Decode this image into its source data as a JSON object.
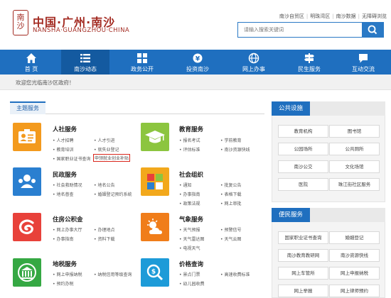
{
  "header": {
    "logo_mark": "南沙",
    "logo_cn": "中国·广州·南沙",
    "logo_en": "NANSHA·GUANGZHOU·CHINA",
    "top_links": [
      "南沙自贸区",
      "明珠湾区",
      "南沙数据",
      "无障碍浏览"
    ],
    "search_placeholder": "请输入搜索关键词",
    "search_icon": "search-icon"
  },
  "nav": {
    "items": [
      {
        "label": "首 页",
        "icon": "home-icon"
      },
      {
        "label": "南沙动态",
        "icon": "list-icon",
        "active": true
      },
      {
        "label": "政务公开",
        "icon": "grid-icon"
      },
      {
        "label": "投资南沙",
        "icon": "coin-icon"
      },
      {
        "label": "网上办事",
        "icon": "globe-icon"
      },
      {
        "label": "民生服务",
        "icon": "signpost-icon"
      },
      {
        "label": "互动交流",
        "icon": "chat-icon"
      }
    ]
  },
  "welcome": "欢迎您光临南沙区政府！",
  "main": {
    "section_title": "主题服务",
    "services": [
      {
        "title": "人社服务",
        "color": "#f39a1d",
        "icon": "id-card-icon",
        "links": [
          "人才招聘",
          "人才引进",
          "教育培训",
          "就失业登记",
          "国家职业证书查询",
          "申领就业创业补贴"
        ],
        "highlight": 5
      },
      {
        "title": "教育服务",
        "color": "#8cc53f",
        "icon": "graduation-cap-icon",
        "links": [
          "报名考试",
          "学前教育",
          "评估标准",
          "南沙资源快线"
        ]
      },
      {
        "title": "民政服务",
        "color": "#2a7fd0",
        "icon": "people-icon",
        "links": [
          "社会救助情况",
          "地名公告",
          "地名普查",
          "婚姻登记预约系统"
        ]
      },
      {
        "title": "社会组织",
        "color": "#f2a81c",
        "icon": "org-grid-icon",
        "links": [
          "通知",
          "批复公告",
          "办事指南",
          "表格下载",
          "政策法规",
          "网上审批"
        ]
      },
      {
        "title": "住房公积金",
        "color": "#e8413a",
        "icon": "swirl-icon",
        "links": [
          "网上办事大厅",
          "办理地点",
          "办事指南",
          "资料下载"
        ]
      },
      {
        "title": "气象服务",
        "color": "#f07d1a",
        "icon": "weather-icon",
        "links": [
          "天气预报",
          "预警信号",
          "天气雷达图",
          "天气云图",
          "电视天气"
        ]
      },
      {
        "title": "地税服务",
        "color": "#35a843",
        "icon": "tax-building-icon",
        "links": [
          "网上申报纳税",
          "纳税信用等级查询",
          "预约办税"
        ]
      },
      {
        "title": "价格查询",
        "color": "#1d9bd8",
        "icon": "price-magnifier-icon",
        "links": [
          "景点门票",
          "高速收费标准",
          "幼儿园收费"
        ]
      }
    ]
  },
  "public_facilities": {
    "title": "公共设施",
    "items": [
      "教育机构",
      "图书馆",
      "公园场所",
      "公共厕所",
      "南沙公交",
      "文化场馆",
      "医院",
      "珠江街社区服务"
    ]
  },
  "convenience": {
    "title": "便民服务",
    "items": [
      "国家职业证书查询",
      "婚姻登记",
      "南沙教育教研网",
      "南沙资源快线",
      "网上车管所",
      "网上申报纳税",
      "网上举报",
      "网上律师预约"
    ]
  }
}
